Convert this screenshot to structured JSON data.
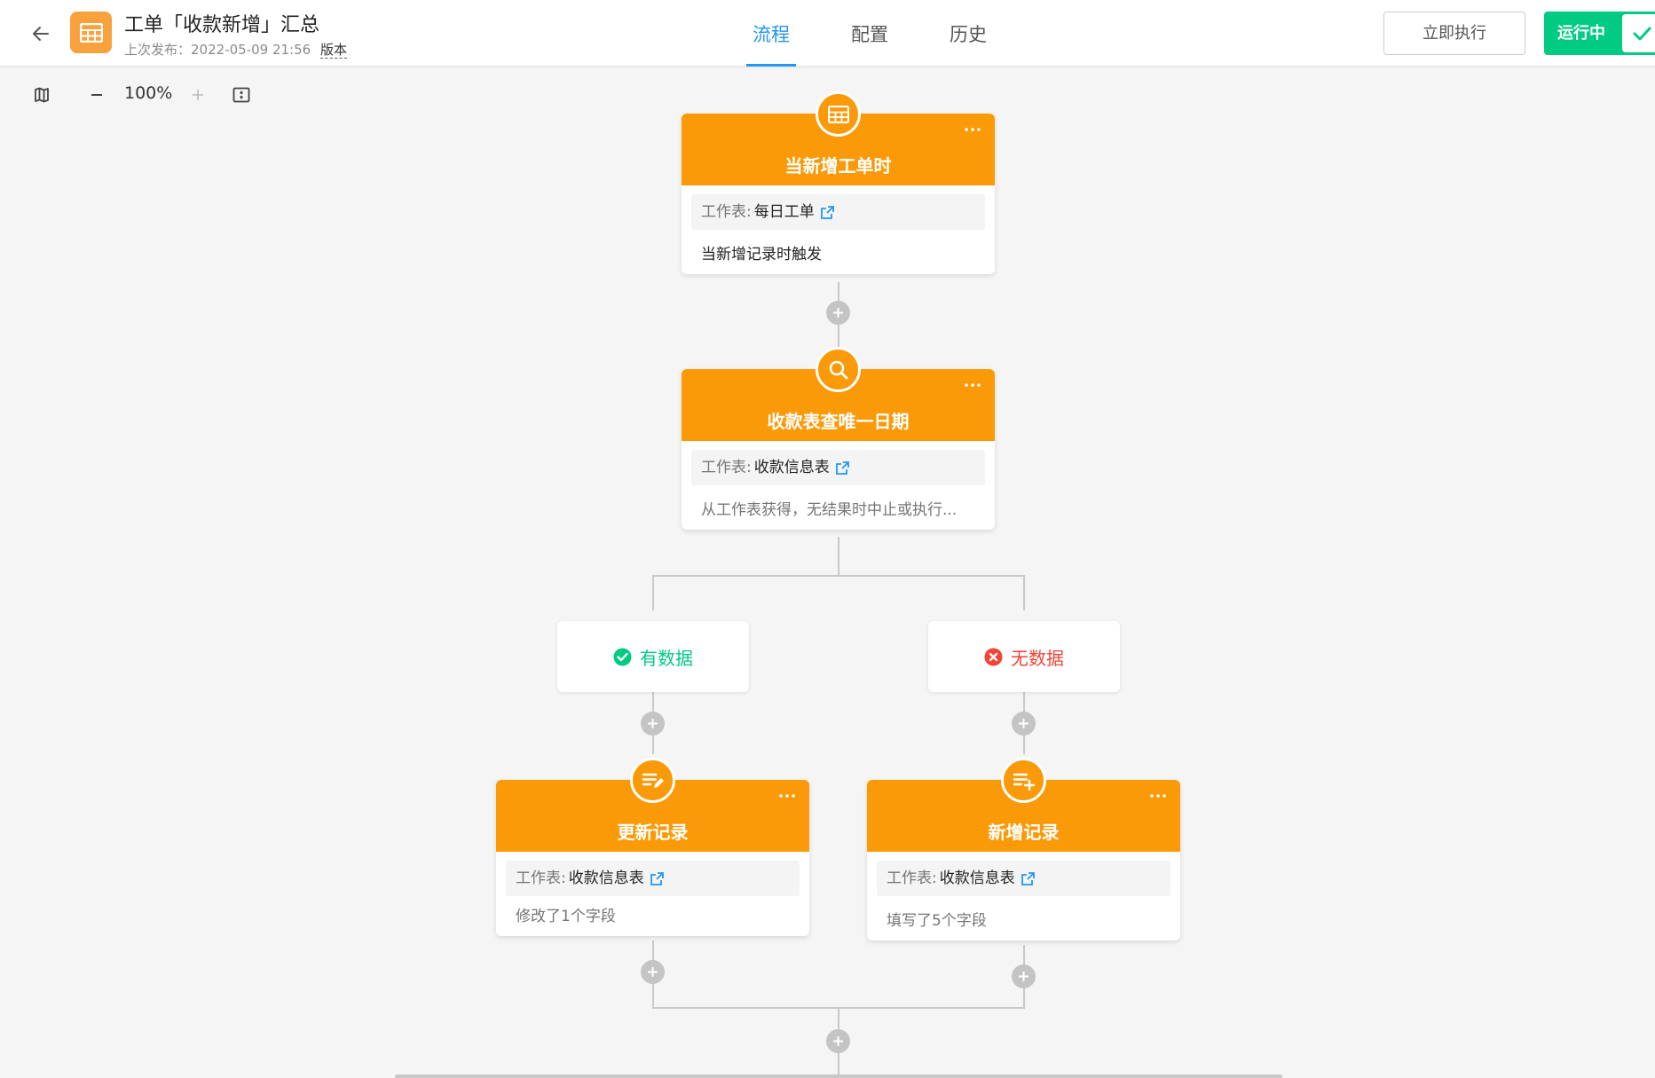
{
  "header": {
    "title": "工单「收款新增」汇总",
    "published_prefix": "上次发布：",
    "published_time": "2022-05-09 21:56",
    "version_label": "版本",
    "tabs": [
      {
        "label": "流程",
        "active": true
      },
      {
        "label": "配置",
        "active": false
      },
      {
        "label": "历史",
        "active": false
      }
    ],
    "run_now_label": "立即执行",
    "status_label": "运行中",
    "status_color": "#01ca83"
  },
  "toolbar": {
    "zoom_level": "100%",
    "icons": [
      "map-icon",
      "zoom-out-icon",
      "zoom-in-icon",
      "fit-screen-icon"
    ]
  },
  "accent_color": "#fa9a09",
  "link_color": "#2196f3",
  "flow": {
    "trigger": {
      "icon": "table-icon",
      "title": "当新增工单时",
      "sheet_key": "工作表:",
      "sheet_value": "每日工单",
      "desc": "当新增记录时触发"
    },
    "query": {
      "icon": "search-icon",
      "title": "收款表查唯一日期",
      "sheet_key": "工作表:",
      "sheet_value": "收款信息表",
      "desc": "从工作表获得，无结果时中止或执行..."
    },
    "branches": [
      {
        "label": "有数据",
        "color": "#01ca83",
        "icon": "check-circle-icon"
      },
      {
        "label": "无数据",
        "color": "#f44336",
        "icon": "close-circle-icon"
      }
    ],
    "update": {
      "icon": "edit-list-icon",
      "title": "更新记录",
      "sheet_key": "工作表:",
      "sheet_value": "收款信息表",
      "desc": "修改了1个字段"
    },
    "add": {
      "icon": "add-list-icon",
      "title": "新增记录",
      "sheet_key": "工作表:",
      "sheet_value": "收款信息表",
      "desc": "填写了5个字段"
    }
  }
}
